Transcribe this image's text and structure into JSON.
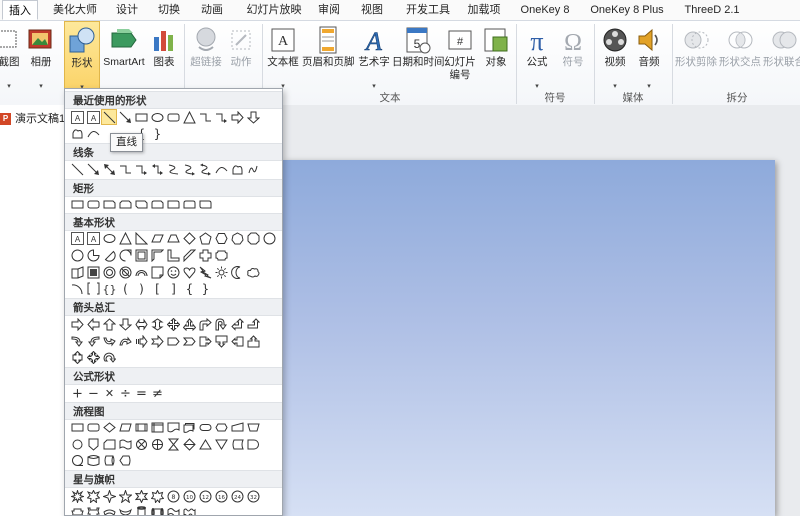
{
  "tabs": [
    {
      "label": "插入",
      "active": true
    },
    {
      "label": "美化大师"
    },
    {
      "label": "设计"
    },
    {
      "label": "切换"
    },
    {
      "label": "动画"
    },
    {
      "label": "幻灯片放映"
    },
    {
      "label": "审阅"
    },
    {
      "label": "视图"
    },
    {
      "label": "开发工具"
    },
    {
      "label": "加载项"
    },
    {
      "label": "OneKey 8"
    },
    {
      "label": "OneKey 8 Plus"
    },
    {
      "label": "ThreeD 2.1"
    }
  ],
  "ribbon": {
    "buttons": [
      {
        "label": "截图",
        "icon": "screenshot-icon"
      },
      {
        "label": "相册",
        "icon": "photo-album-icon"
      },
      {
        "label": "形状",
        "icon": "shapes-icon",
        "pressed": true
      },
      {
        "label": "SmartArt",
        "icon": "smartart-icon"
      },
      {
        "label": "图表",
        "icon": "chart-icon"
      },
      {
        "label": "超链接",
        "icon": "hyperlink-icon",
        "disabled": true
      },
      {
        "label": "动作",
        "icon": "action-icon",
        "disabled": true
      },
      {
        "label": "文本框",
        "icon": "textbox-icon"
      },
      {
        "label": "页眉和页脚",
        "icon": "header-footer-icon"
      },
      {
        "label": "艺术字",
        "icon": "wordart-icon"
      },
      {
        "label": "日期和时间",
        "icon": "datetime-icon"
      },
      {
        "label": "幻灯片",
        "label2": "编号",
        "icon": "slide-number-icon"
      },
      {
        "label": "对象",
        "icon": "object-icon"
      },
      {
        "label": "公式",
        "icon": "equation-icon"
      },
      {
        "label": "符号",
        "icon": "symbol-icon",
        "disabled": true
      },
      {
        "label": "视频",
        "icon": "video-icon"
      },
      {
        "label": "音频",
        "icon": "audio-icon"
      },
      {
        "label": "形状剪除",
        "icon": "shape-subtract-icon",
        "disabled": true
      },
      {
        "label": "形状交点",
        "icon": "shape-intersect-icon",
        "disabled": true
      },
      {
        "label": "形状联合",
        "icon": "shape-union-icon",
        "disabled": true
      }
    ],
    "groups": [
      "文本",
      "符号",
      "媒体",
      "拆分"
    ]
  },
  "document": {
    "tab_label": "演示文稿1",
    "app_badge": "P"
  },
  "shapes_menu": {
    "sections": [
      {
        "title": "最近使用的形状"
      },
      {
        "title": "线条"
      },
      {
        "title": "矩形"
      },
      {
        "title": "基本形状"
      },
      {
        "title": "箭头总汇"
      },
      {
        "title": "公式形状"
      },
      {
        "title": "流程图"
      },
      {
        "title": "星与旗帜"
      }
    ],
    "tooltip": "直线",
    "equation_glyphs": [
      "+",
      "−",
      "✕",
      "÷",
      "=",
      "≠"
    ],
    "bracket_glyphs": [
      "{",
      "}",
      "(",
      ")",
      "[",
      "]"
    ]
  }
}
